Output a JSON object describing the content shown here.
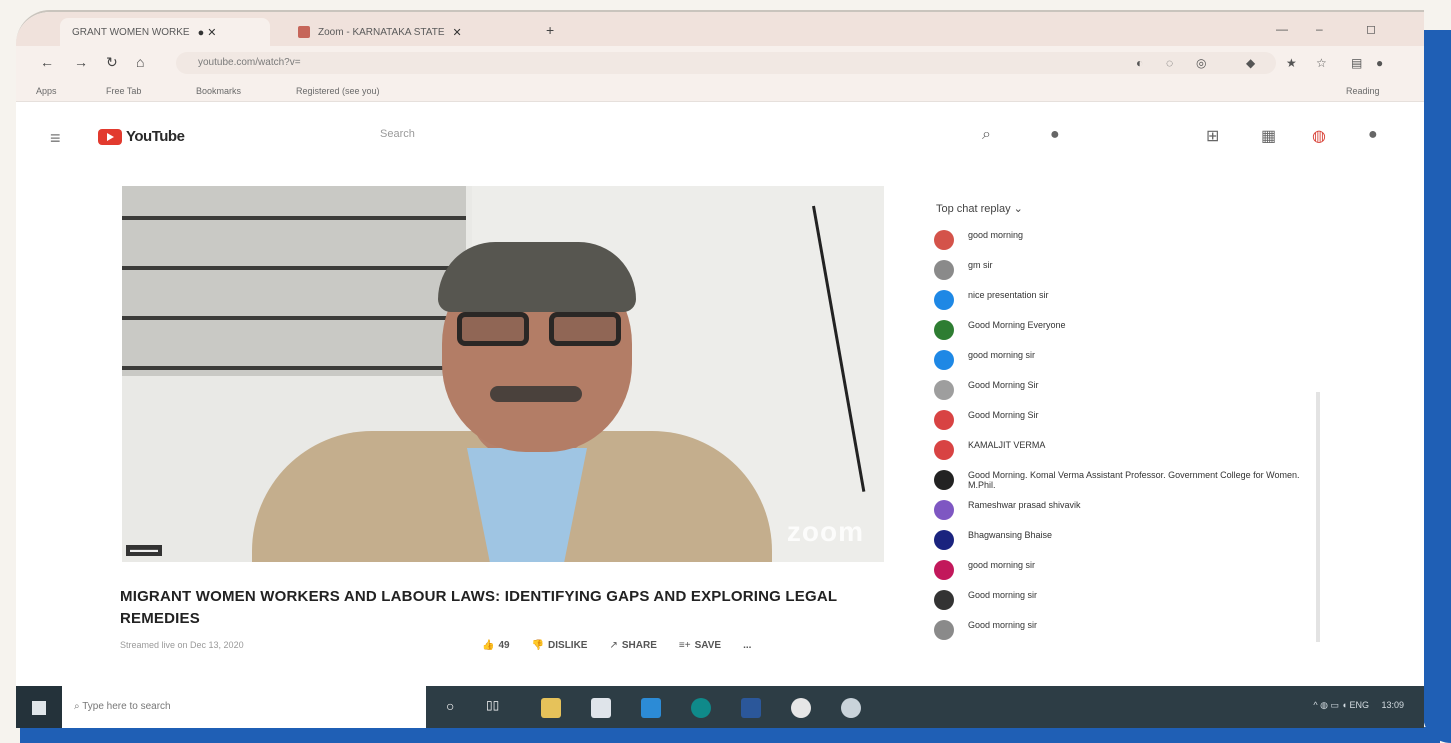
{
  "browser": {
    "tabs": [
      {
        "label": "GRANT WOMEN WORKE",
        "active": true
      },
      {
        "label": "Zoom - KARNATAKA STATE",
        "active": false
      }
    ],
    "new_tab_label": "+",
    "url": "youtube.com/watch?v=",
    "bookmarks": [
      "Apps",
      "Free Tab",
      "Bookmarks",
      "Registered (see you)"
    ],
    "reading_list_label": "Reading"
  },
  "youtube": {
    "brand": "YouTube",
    "search_placeholder": "Search"
  },
  "video": {
    "watermark": "zoom",
    "title": "MIGRANT WOMEN WORKERS AND LABOUR LAWS: IDENTIFYING GAPS AND EXPLORING LEGAL REMEDIES",
    "meta": "Streamed live on Dec 13, 2020",
    "likes": "49",
    "dislike_label": "DISLIKE",
    "share_label": "SHARE",
    "save_label": "SAVE",
    "more_label": "..."
  },
  "chat": {
    "header": "Top chat replay",
    "messages": [
      {
        "author": "",
        "text": "good morning",
        "color": "#d4534a"
      },
      {
        "author": "",
        "text": "gm sir",
        "color": "#8a8a8a"
      },
      {
        "author": "",
        "text": "nice presentation sir",
        "color": "#1e88e5"
      },
      {
        "author": "",
        "text": "Good Morning Everyone",
        "color": "#2e7d32"
      },
      {
        "author": "",
        "text": "good morning sir",
        "color": "#1e88e5"
      },
      {
        "author": "",
        "text": "Good Morning Sir",
        "color": "#9e9e9e"
      },
      {
        "author": "",
        "text": "Good Morning Sir",
        "color": "#d84343"
      },
      {
        "author": "",
        "text": "KAMALJIT VERMA",
        "color": "#d84343"
      },
      {
        "author": "",
        "text": "Good Morning. Komal Verma Assistant Professor. Government College for Women. M.Phil.",
        "color": "#222222"
      },
      {
        "author": "",
        "text": "Rameshwar prasad shivavik",
        "color": "#7e57c2"
      },
      {
        "author": "",
        "text": "Bhagwansing Bhaise",
        "color": "#1a237e"
      },
      {
        "author": "",
        "text": "good morning sir",
        "color": "#c2185b"
      },
      {
        "author": "",
        "text": "Good morning sir",
        "color": "#333333"
      },
      {
        "author": "",
        "text": "Good morning sir",
        "color": "#8a8a8a"
      }
    ]
  },
  "taskbar": {
    "search_placeholder": "Type here to search",
    "language": "ENG",
    "time": "13:09"
  }
}
